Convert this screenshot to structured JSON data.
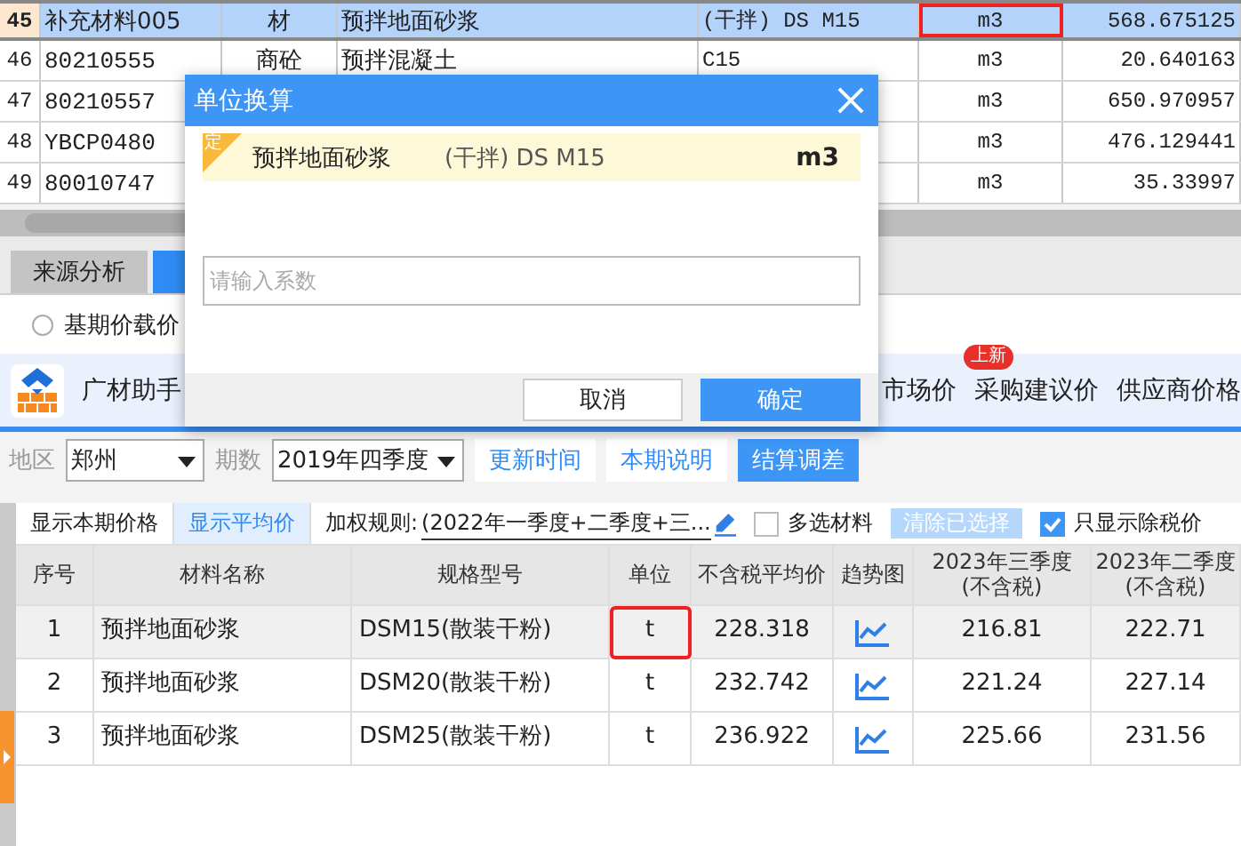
{
  "grid": {
    "rows": [
      {
        "num": "45",
        "code": "补充材料005",
        "type": "材",
        "name": "预拌地面砂浆",
        "spec": "(干拌) DS M15",
        "unit": "m3",
        "price": "568.675125",
        "selected": true,
        "unit_highlighted": true
      },
      {
        "num": "46",
        "code": "80210555",
        "type": "商砼",
        "name": "预拌混凝土",
        "spec": "C15",
        "unit": "m3",
        "price": "20.640163",
        "selected": false,
        "unit_highlighted": false
      },
      {
        "num": "47",
        "code": "80210557",
        "unit": "m3",
        "price": "650.970957",
        "selected": false,
        "unit_highlighted": false
      },
      {
        "num": "48",
        "code": "YBCP0480",
        "unit": "m3",
        "price": "476.129441",
        "selected": false,
        "unit_highlighted": false
      },
      {
        "num": "49",
        "code": "80010747",
        "unit": "m3",
        "price": "35.33997",
        "selected": false,
        "unit_highlighted": false
      }
    ]
  },
  "source_tabs": [
    {
      "label": "来源分析",
      "selected": false
    },
    {
      "selected": true
    }
  ],
  "radio": {
    "label": "基期价载价",
    "checked": false
  },
  "assistant": {
    "title": "广材助手",
    "tabs": [
      {
        "label": "市场价"
      },
      {
        "label": "采购建议价",
        "badge": "上新"
      },
      {
        "label": "供应商价格"
      }
    ]
  },
  "filters": {
    "region_label": "地区",
    "region": "郑州",
    "period_label": "期数",
    "period": "2019年四季度",
    "buttons": [
      {
        "label": "更新时间",
        "primary": false
      },
      {
        "label": "本期说明",
        "primary": false
      },
      {
        "label": "结算调差",
        "primary": true
      }
    ]
  },
  "options": {
    "views": [
      {
        "label": "显示本期价格",
        "selected": false
      },
      {
        "label": "显示平均价",
        "selected": true
      }
    ],
    "weight_label": "加权规则:",
    "weight_value": "(2022年一季度+二季度+三...",
    "multi_select": {
      "label": "多选材料",
      "checked": false
    },
    "clear": {
      "label": "清除已选择",
      "disabled": true
    },
    "tax_only": {
      "label": "只显示除税价",
      "checked": true
    }
  },
  "table": {
    "columns": [
      "序号",
      "材料名称",
      "规格型号",
      "单位",
      "不含税平均价",
      "趋势图",
      "2023年三季度\n(不含税)",
      "2023年二季度\n(不含税)"
    ],
    "rows": [
      {
        "index": "1",
        "name": "预拌地面砂浆",
        "spec": "DSM15(散装干粉)",
        "unit": "t",
        "avg": "228.318",
        "q3": "216.81",
        "q2": "222.71",
        "selected": true,
        "unit_highlighted": true
      },
      {
        "index": "2",
        "name": "预拌地面砂浆",
        "spec": "DSM20(散装干粉)",
        "unit": "t",
        "avg": "232.742",
        "q3": "221.24",
        "q2": "227.14",
        "selected": false,
        "unit_highlighted": false
      },
      {
        "index": "3",
        "name": "预拌地面砂浆",
        "spec": "DSM25(散装干粉)",
        "unit": "t",
        "avg": "236.922",
        "q3": "225.66",
        "q2": "231.56",
        "selected": false,
        "unit_highlighted": false
      }
    ]
  },
  "dialog": {
    "title": "单位换算",
    "item": {
      "tag": "定",
      "name": "预拌地面砂浆",
      "spec": "(干拌) DS M15",
      "unit": "m3"
    },
    "input": {
      "placeholder": "请输入系数"
    },
    "buttons": [
      {
        "label": "取消",
        "primary": false
      },
      {
        "label": "确定",
        "primary": true
      }
    ]
  }
}
